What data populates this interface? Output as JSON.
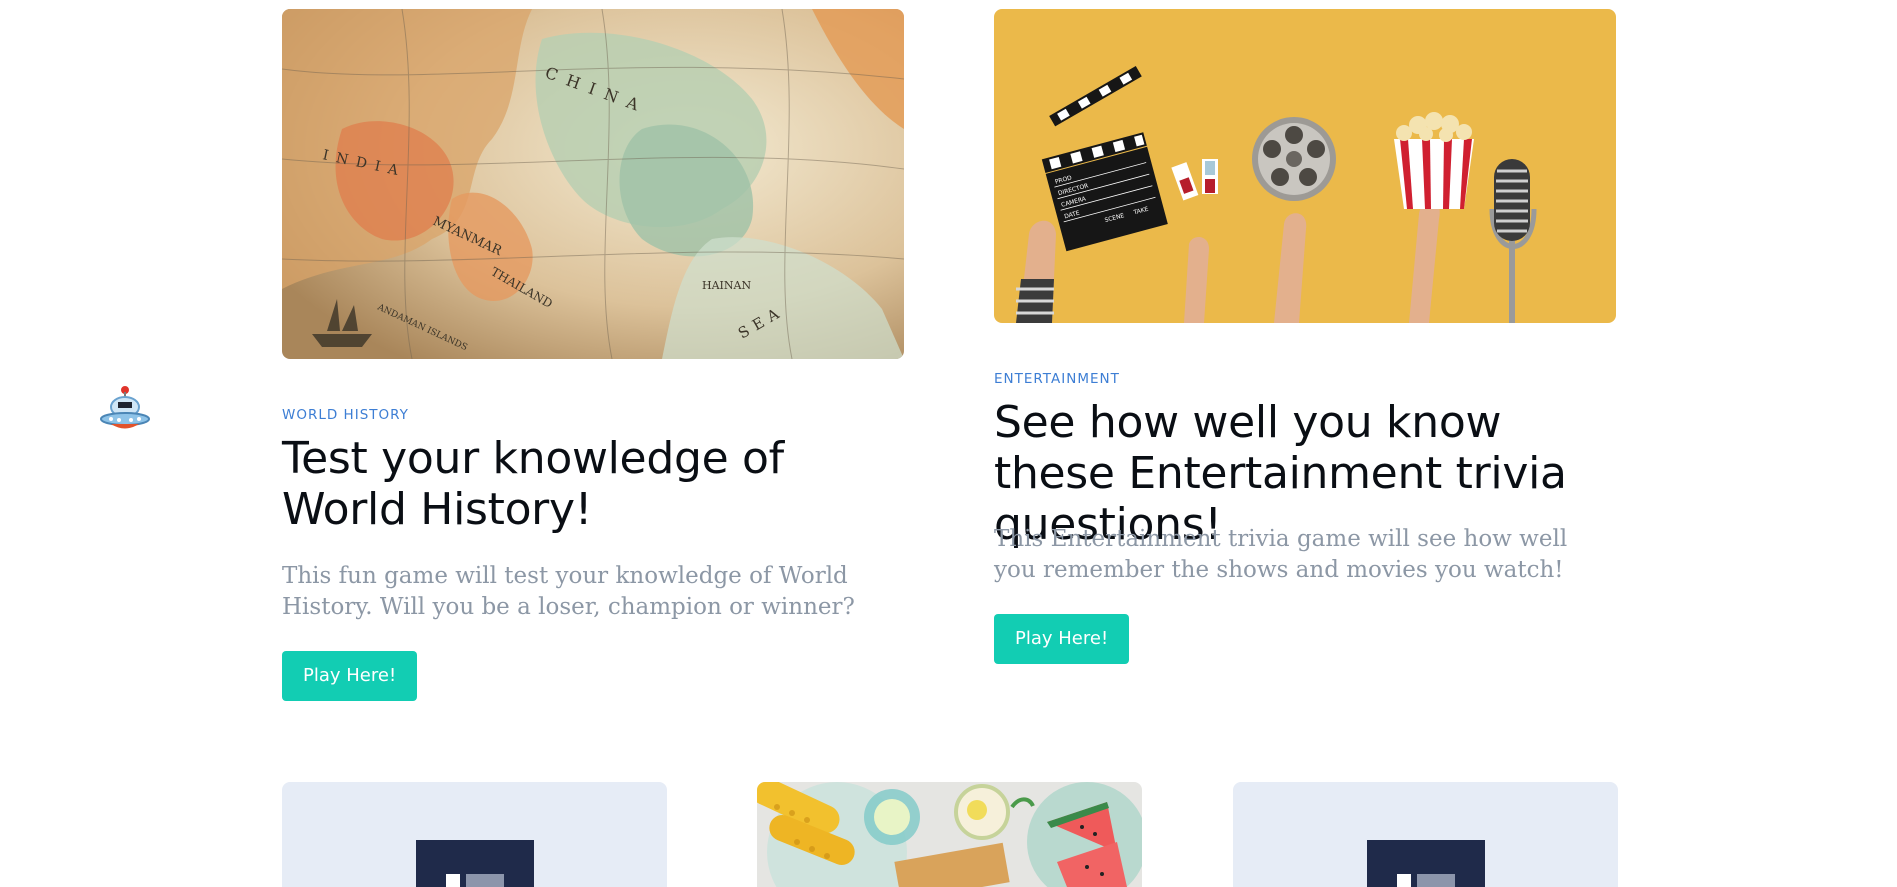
{
  "cards": [
    {
      "category": "WORLD HISTORY",
      "title": "Test your knowledge of World History!",
      "description": "This fun game will test your knowledge of World History. Will you be a loser, champion or winner?",
      "button": "Play Here!"
    },
    {
      "category": "ENTERTAINMENT",
      "title": "See how well you know these Entertainment trivia questions!",
      "description": "This Entertainment trivia game will see how well you remember the shows and movies you watch!",
      "button": "Play Here!"
    }
  ],
  "map_labels": [
    "CHINA",
    "INDIA",
    "MYANMAR",
    "THAILAND",
    "ANDAMAN ISLANDS",
    "HAINAN",
    "SEA"
  ],
  "clapper_text": [
    "PROD",
    "DIRECTOR",
    "CAMERA",
    "DATE",
    "SCENE",
    "TAKE"
  ],
  "colors": {
    "accent_button": "#12cdb3",
    "eyebrow": "#3d7ed4",
    "entertainment_bg": "#ebb94a",
    "tile_bg": "#e6ecf6"
  },
  "icons": [
    "robot-mascot-icon"
  ]
}
